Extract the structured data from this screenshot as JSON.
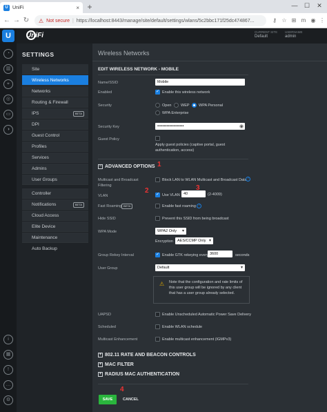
{
  "browser": {
    "tab_title": "UniFi",
    "tab_close": "×",
    "new_tab": "+",
    "not_secure": "Not secure",
    "url": "https://localhost:8443/manage/site/default/settings/wlans/5c2bbc171f25dc474867..."
  },
  "header": {
    "brand": "UniFi",
    "current_site_label": "CURRENT SITE",
    "current_site": "Default",
    "username_label": "USERNAME",
    "username": "admin"
  },
  "sidebar": {
    "title": "SETTINGS",
    "items": [
      {
        "label": "Site"
      },
      {
        "label": "Wireless Networks"
      },
      {
        "label": "Networks"
      },
      {
        "label": "Routing & Firewall"
      },
      {
        "label": "IPS",
        "badge": "BETA"
      },
      {
        "label": "DPI"
      },
      {
        "label": "Guest Control"
      },
      {
        "label": "Profiles"
      },
      {
        "label": "Services"
      },
      {
        "label": "Admins"
      },
      {
        "label": "User Groups"
      },
      {
        "label": "Controller"
      },
      {
        "label": "Notifications",
        "badge": "BETA"
      },
      {
        "label": "Cloud Access"
      },
      {
        "label": "Elite Device"
      },
      {
        "label": "Maintenance"
      },
      {
        "label": "Auto Backup"
      }
    ]
  },
  "main": {
    "page_title": "Wireless Networks",
    "edit_title": "EDIT WIRELESS NETWORK - MOBILE",
    "name_label": "Name/SSID",
    "name_value": "Mobile",
    "enabled_label": "Enabled",
    "enabled_text": "Enable this wireless network",
    "security_label": "Security",
    "security_open": "Open",
    "security_wep": "WEP",
    "security_wpa": "WPA Personal",
    "security_wpa_ent": "WPA Enterprise",
    "security_key_label": "Security Key",
    "security_key_value": "••••••••••••••••••••",
    "guest_label": "Guest Policy",
    "guest_text": "Apply guest policies (captive portal, guest authentication, access)",
    "advanced_title": "ADVANCED OPTIONS",
    "multicast_label": "Multicast and Broadcast Filtering",
    "multicast_text": "Block LAN to WLAN Multicast and Broadcast Data",
    "vlan_label": "VLAN",
    "vlan_text": "Use VLAN",
    "vlan_value": "40",
    "vlan_range": "(2-4009)",
    "fast_roaming_label": "Fast Roaming",
    "fast_roaming_badge": "BETA",
    "fast_roaming_text": "Enable fast roaming",
    "hide_ssid_label": "Hide SSID",
    "hide_ssid_text": "Prevent this SSID from being broadcast",
    "wpa_mode_label": "WPA Mode",
    "wpa_mode_value": "WPA2 Only",
    "encryption_label": "Encryption",
    "encryption_value": "AES/CCMP Only",
    "gtk_label": "Group Rekey Interval",
    "gtk_text": "Enable GTK rekeying every",
    "gtk_value": "3600",
    "gtk_unit": "seconds",
    "user_group_label": "User Group",
    "user_group_value": "Default",
    "note_text": "Note that the configuration and rate limits of this user group will be ignored by any client that has a user group already selected.",
    "uapsd_label": "UAPSD",
    "uapsd_text": "Enable Unscheduled Automatic Power Save Delivery",
    "scheduled_label": "Scheduled",
    "scheduled_text": "Enable WLAN schedule",
    "multicast_enh_label": "Multicast Enhancement",
    "multicast_enh_text": "Enable multicast enhancement (IGMPv3)",
    "sec_rate": "802.11 RATE AND BEACON CONTROLS",
    "sec_mac": "MAC FILTER",
    "sec_radius": "RADIUS MAC AUTHENTICATION",
    "save": "SAVE",
    "cancel": "CANCEL"
  },
  "annotations": {
    "n1": "1",
    "n2": "2",
    "n3": "3",
    "n4": "4"
  },
  "colors": {
    "accent": "#1a7fe0",
    "save": "#2ab53d",
    "annotation": "#e33333"
  }
}
